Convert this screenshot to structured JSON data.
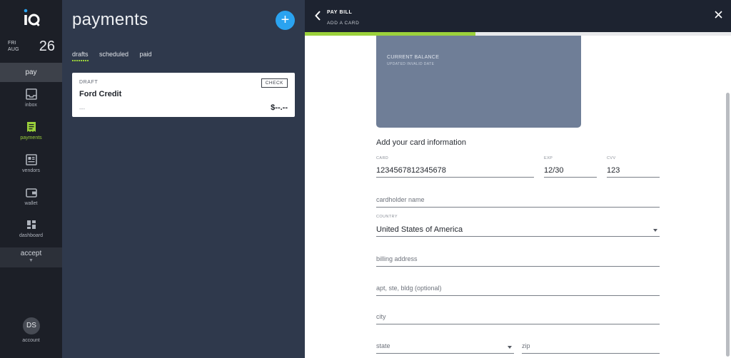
{
  "rail": {
    "logo_text": "iQ",
    "date": {
      "dow": "FRI",
      "month": "AUG",
      "day": "26"
    },
    "pay_label": "pay",
    "items": [
      {
        "label": "inbox",
        "icon": "inbox-icon"
      },
      {
        "label": "payments",
        "icon": "receipt-icon"
      },
      {
        "label": "vendors",
        "icon": "vendors-icon"
      },
      {
        "label": "wallet",
        "icon": "wallet-icon"
      },
      {
        "label": "dashboard",
        "icon": "dashboard-icon"
      }
    ],
    "accept_label": "accept",
    "avatar_initials": "DS",
    "account_label": "account"
  },
  "panel": {
    "title": "payments",
    "tabs": [
      {
        "label": "drafts"
      },
      {
        "label": "scheduled"
      },
      {
        "label": "paid"
      }
    ],
    "card": {
      "status": "DRAFT",
      "method": "CHECK",
      "name": "Ford Credit",
      "sub": "---",
      "amount": "$--.--"
    }
  },
  "drawer": {
    "title": "PAY BILL",
    "subtitle": "ADD A CARD",
    "progress_fraction": 0.4,
    "balance": {
      "label": "CURRENT BALANCE",
      "sub": "UPDATED INVALID DATE"
    },
    "section_title": "Add your card information",
    "fields": {
      "card": {
        "label": "CARD",
        "value": "1234567812345678"
      },
      "exp": {
        "label": "EXP",
        "value": "12/30"
      },
      "cvv": {
        "label": "CVV",
        "value": "123"
      },
      "cardholder": {
        "placeholder": "cardholder name"
      },
      "country": {
        "label": "COUNTRY",
        "value": "United States of America"
      },
      "billing": {
        "placeholder": "billing address"
      },
      "apt": {
        "placeholder": "apt, ste, bldg (optional)"
      },
      "city": {
        "placeholder": "city"
      },
      "state": {
        "placeholder": "state"
      },
      "zip": {
        "placeholder": "zip"
      }
    }
  },
  "colors": {
    "accent": "#9bd13b",
    "add_button": "#2aa3f0",
    "panel_bg": "#2f394c",
    "card_bg": "#6f7e97"
  }
}
